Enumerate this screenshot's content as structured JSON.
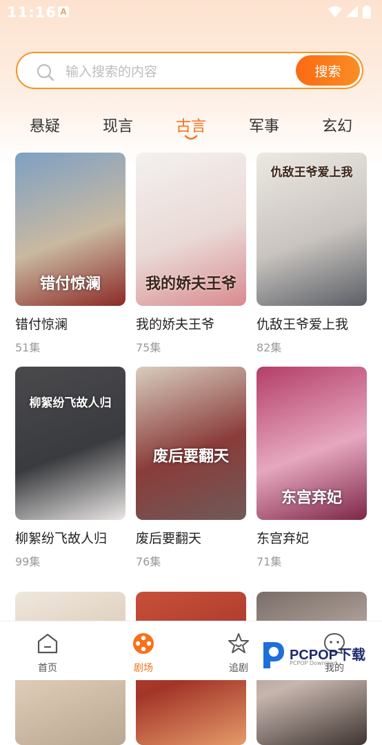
{
  "status": {
    "time": "11:16",
    "notification_letter": "A"
  },
  "search": {
    "placeholder": "输入搜索的内容",
    "button_label": "搜索"
  },
  "tabs": [
    {
      "label": "悬疑"
    },
    {
      "label": "现言"
    },
    {
      "label": "古言",
      "active": true
    },
    {
      "label": "军事"
    },
    {
      "label": "玄幻"
    }
  ],
  "dramas": [
    {
      "title": "错付惊澜",
      "episodes": "51集",
      "poster_text": "错付惊澜",
      "colors": [
        "#7da0c4",
        "#c9b9a1",
        "#8b2a25"
      ]
    },
    {
      "title": "我的娇夫王爷",
      "episodes": "75集",
      "poster_text": "我的娇夫王爷",
      "colors": [
        "#f4f1ef",
        "#e9d9d6",
        "#d98a8f"
      ]
    },
    {
      "title": "仇敌王爷爱上我",
      "episodes": "82集",
      "poster_text": "仇敌王爷爱上我",
      "colors": [
        "#ece8e2",
        "#c9c4bf",
        "#5a5e66"
      ]
    },
    {
      "title": "柳絮纷飞故人归",
      "episodes": "99集",
      "poster_text": "柳絮纷飞故人归",
      "colors": [
        "#4a4a4d",
        "#3a3b3f",
        "#e9e6e4"
      ]
    },
    {
      "title": "废后要翻天",
      "episodes": "76集",
      "poster_text": "废后要翻天",
      "colors": [
        "#d8cdbf",
        "#8a3c3a",
        "#6f5a58"
      ]
    },
    {
      "title": "东宫弃妃",
      "episodes": "71集",
      "poster_text": "东宫弃妃",
      "colors": [
        "#b43e68",
        "#e6a7bf",
        "#7d2746"
      ]
    },
    {
      "title": "",
      "episodes": "",
      "poster_text": "",
      "colors": [
        "#efe7dc",
        "#d9c6b1",
        "#b9a792"
      ]
    },
    {
      "title": "",
      "episodes": "",
      "poster_text": "",
      "colors": [
        "#c8503a",
        "#a33528",
        "#e59a6a"
      ]
    },
    {
      "title": "",
      "episodes": "",
      "poster_text": "",
      "colors": [
        "#7a6e68",
        "#c7b6ae",
        "#3f3532"
      ]
    }
  ],
  "bottom_nav": [
    {
      "label": "首页",
      "icon": "home-icon"
    },
    {
      "label": "剧场",
      "icon": "film-reel-icon",
      "active": true
    },
    {
      "label": "追剧",
      "icon": "star-icon"
    },
    {
      "label": "我的",
      "icon": "profile-icon"
    }
  ],
  "watermark": {
    "text": "PCPOP下载",
    "sub": "PCPOP Download"
  },
  "colors": {
    "accent": "#f7711a",
    "search_border": "#f7931e"
  }
}
